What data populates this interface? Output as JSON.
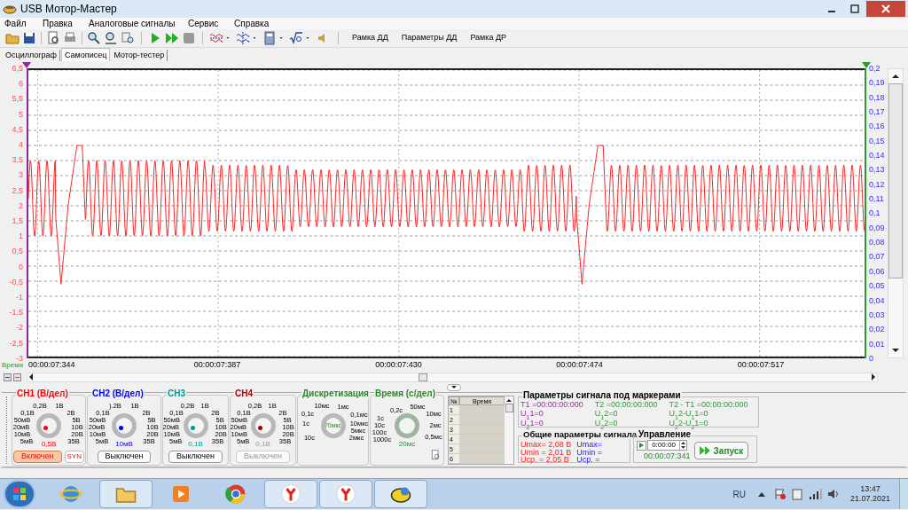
{
  "window": {
    "title": "USB Мотор-Мастер"
  },
  "menu": [
    "Файл",
    "Правка",
    "Аналоговые сигналы",
    "Сервис",
    "Справка"
  ],
  "toolbar": {
    "text_buttons": [
      "Рамка ДД",
      "Параметры ДД",
      "Рамка ДР"
    ]
  },
  "tabs": [
    {
      "label": "Осциллограф",
      "selected": false
    },
    {
      "label": "Самописец",
      "selected": true
    },
    {
      "label": "Мотор-тестер",
      "selected": false
    }
  ],
  "chart": {
    "left_axis": [
      "6,5",
      "6",
      "5,5",
      "5",
      "4,5",
      "4",
      "3,5",
      "3",
      "2,5",
      "2",
      "1,5",
      "1",
      "0,5",
      "0",
      "-0,5",
      "-1",
      "-1,5",
      "-2",
      "-2,5",
      "-3"
    ],
    "right_axis": [
      "0,2",
      "0,19",
      "0,18",
      "0,17",
      "0,16",
      "0,15",
      "0,14",
      "0,13",
      "0,12",
      "0,11",
      "0,1",
      "0,09",
      "0,08",
      "0,07",
      "0,06",
      "0,05",
      "0,04",
      "0,03",
      "0,02",
      "0,01",
      "0"
    ],
    "time_label": "Время",
    "time_ticks": [
      "00:00:07:344",
      "00:00:07:387",
      "00:00:07:430",
      "00:00:07:474",
      "00:00:07:517"
    ]
  },
  "channels": [
    {
      "title": "CH1 (В/дел)",
      "color": "#ff0000",
      "scale": [
        "0,2В",
        "1В",
        "0,1В",
        "2В",
        "50мВ",
        "5В",
        "20мВ",
        "10В",
        "10мВ",
        "20В",
        "5мВ",
        "35В"
      ],
      "value": "0,5В",
      "button": "Включен",
      "on": true,
      "disabled": false,
      "syn": "SYN"
    },
    {
      "title": "CH2 (В/дел)",
      "color": "#0000ff",
      "scale": [
        ").2В",
        "1В",
        "0,1В",
        "2В",
        "50мВ",
        "5В",
        "20мВ",
        "10В",
        "10мВ",
        "20В",
        "5мВ",
        "35В"
      ],
      "value": "10мВ",
      "button": "Выключен",
      "on": false,
      "disabled": false
    },
    {
      "title": "CH3",
      "color": "#009999",
      "scale": [
        "0,2В",
        "1В",
        "0,1В",
        "2В",
        "50мВ",
        "5В",
        "20мВ",
        "10В",
        "10мВ",
        "20В",
        "5мВ",
        "35В"
      ],
      "value": "0,1В",
      "button": "Выключен",
      "on": false,
      "disabled": false
    },
    {
      "title": "CH4",
      "color": "#aa0000",
      "scale": [
        "0,2В",
        "1В",
        "0,1В",
        "2В",
        "50мВ",
        "5В",
        "20мВ",
        "10В",
        "10мВ",
        "20В",
        "5мВ",
        "35В"
      ],
      "value": "0,1В",
      "button": "Выключен",
      "on": false,
      "disabled": true
    }
  ],
  "sampling": {
    "title": "Дискретизация",
    "scale": [
      "10мс",
      "1мс",
      "0,1с",
      "0,1мс",
      "1с",
      "10мкс",
      "5мкс",
      "10с",
      "2мкс"
    ],
    "value": "70мкс"
  },
  "timebase": {
    "title": "Время (с/дел)",
    "scale": [
      "50мс",
      "0,2с",
      "10мс",
      "1с",
      "10с",
      "2мс",
      "100с",
      "0,5мс",
      "1000с"
    ],
    "value": "20мс"
  },
  "markers_table": {
    "columns": [
      "№",
      "Время"
    ],
    "rows": [
      "1",
      "2",
      "3",
      "4",
      "5",
      "6"
    ]
  },
  "marker_params": {
    "title": "Параметры сигнала под маркерами",
    "columns": [
      [
        "T1 =00:00:00:000",
        "U$_{1}$1=0",
        "U$_{2}$1=0"
      ],
      [
        "T2 =00:00:00:000",
        "U$_{1}$2=0",
        "U$_{2}$2=0"
      ],
      [
        "T2 - T1 =00:00:00:000",
        "U$_{1}$2-U$_{1}$1=0",
        "U$_{2}$2-U$_{2}$1=0"
      ]
    ]
  },
  "general_params": {
    "title": "Общие параметры сигнала",
    "columns": [
      [
        "Umax= 2,08 В",
        "Umin = 2,01 В",
        "Ucp. = 2,05 В"
      ],
      [
        "Umax=",
        "Umin =",
        "Ucp. ="
      ]
    ]
  },
  "control": {
    "title": "Управление",
    "spinner_value": "0:00:00",
    "elapsed": "00:00:07:341",
    "start_button": "Запуск"
  },
  "taskbar": {
    "language": "RU",
    "time": "13:47",
    "date": "21.07.2021"
  }
}
